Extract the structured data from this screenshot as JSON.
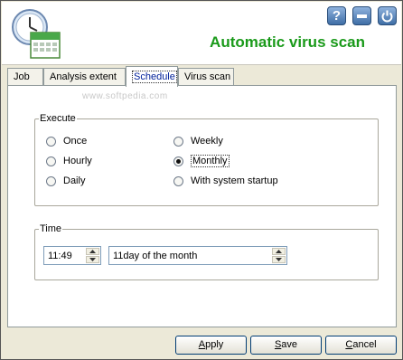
{
  "header": {
    "title": "Automatic virus scan",
    "help_label": "?",
    "app_icon": "clock-calendar-icon",
    "minimize_icon": "minimize-icon",
    "close_icon": "power-icon"
  },
  "tabs": [
    {
      "label": "Job"
    },
    {
      "label": "Analysis extent"
    },
    {
      "label": "Schedule",
      "active": true
    },
    {
      "label": "Virus scan"
    }
  ],
  "watermark": "www.softpedia.com",
  "execute": {
    "legend": "Execute",
    "options": [
      {
        "label": "Once",
        "checked": false
      },
      {
        "label": "Hourly",
        "checked": false
      },
      {
        "label": "Daily",
        "checked": false
      },
      {
        "label": "Weekly",
        "checked": false
      },
      {
        "label": "Monthly",
        "checked": true
      },
      {
        "label": "With system startup",
        "checked": false
      }
    ]
  },
  "time": {
    "legend": "Time",
    "time_value": "11:49",
    "day_value": "11day of the month"
  },
  "buttons": {
    "apply": {
      "first": "A",
      "rest": "pply"
    },
    "save": {
      "first": "S",
      "rest": "ave"
    },
    "cancel": {
      "first": "C",
      "rest": "ancel"
    }
  },
  "colors": {
    "title": "#1a9a1a",
    "active_tab_text": "#00209a",
    "window_bg": "#ece9d8"
  }
}
